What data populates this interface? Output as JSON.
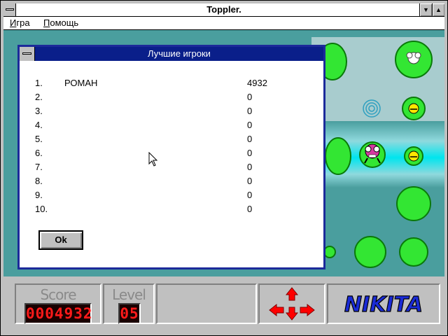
{
  "window": {
    "title": "Toppler."
  },
  "menu": {
    "items": [
      {
        "label": "Игра"
      },
      {
        "label": "Помощь"
      }
    ]
  },
  "dialog": {
    "title": "Лучшие игроки",
    "rows": [
      {
        "rank": "1.",
        "name": "РОМАН",
        "score": "4932"
      },
      {
        "rank": "2.",
        "name": "",
        "score": "0"
      },
      {
        "rank": "3.",
        "name": "",
        "score": "0"
      },
      {
        "rank": "4.",
        "name": "",
        "score": "0"
      },
      {
        "rank": "5.",
        "name": "",
        "score": "0"
      },
      {
        "rank": "6.",
        "name": "",
        "score": "0"
      },
      {
        "rank": "7.",
        "name": "",
        "score": "0"
      },
      {
        "rank": "8.",
        "name": "",
        "score": "0"
      },
      {
        "rank": "9.",
        "name": "",
        "score": "0"
      },
      {
        "rank": "10.",
        "name": "",
        "score": "0"
      }
    ],
    "ok_label": "Ok"
  },
  "panel": {
    "score_label": "Score",
    "score_value": "0004932",
    "level_label": "Level",
    "level_value": "05",
    "logo_text": "NIKITA"
  },
  "colors": {
    "water": "#4a9e9e",
    "lilypad": "#33e633",
    "dialog_title": "#0a1f8a",
    "lcd_red": "#ff1a1a",
    "arrow_red": "#ff0000",
    "logo_blue": "#1a2bd6"
  }
}
